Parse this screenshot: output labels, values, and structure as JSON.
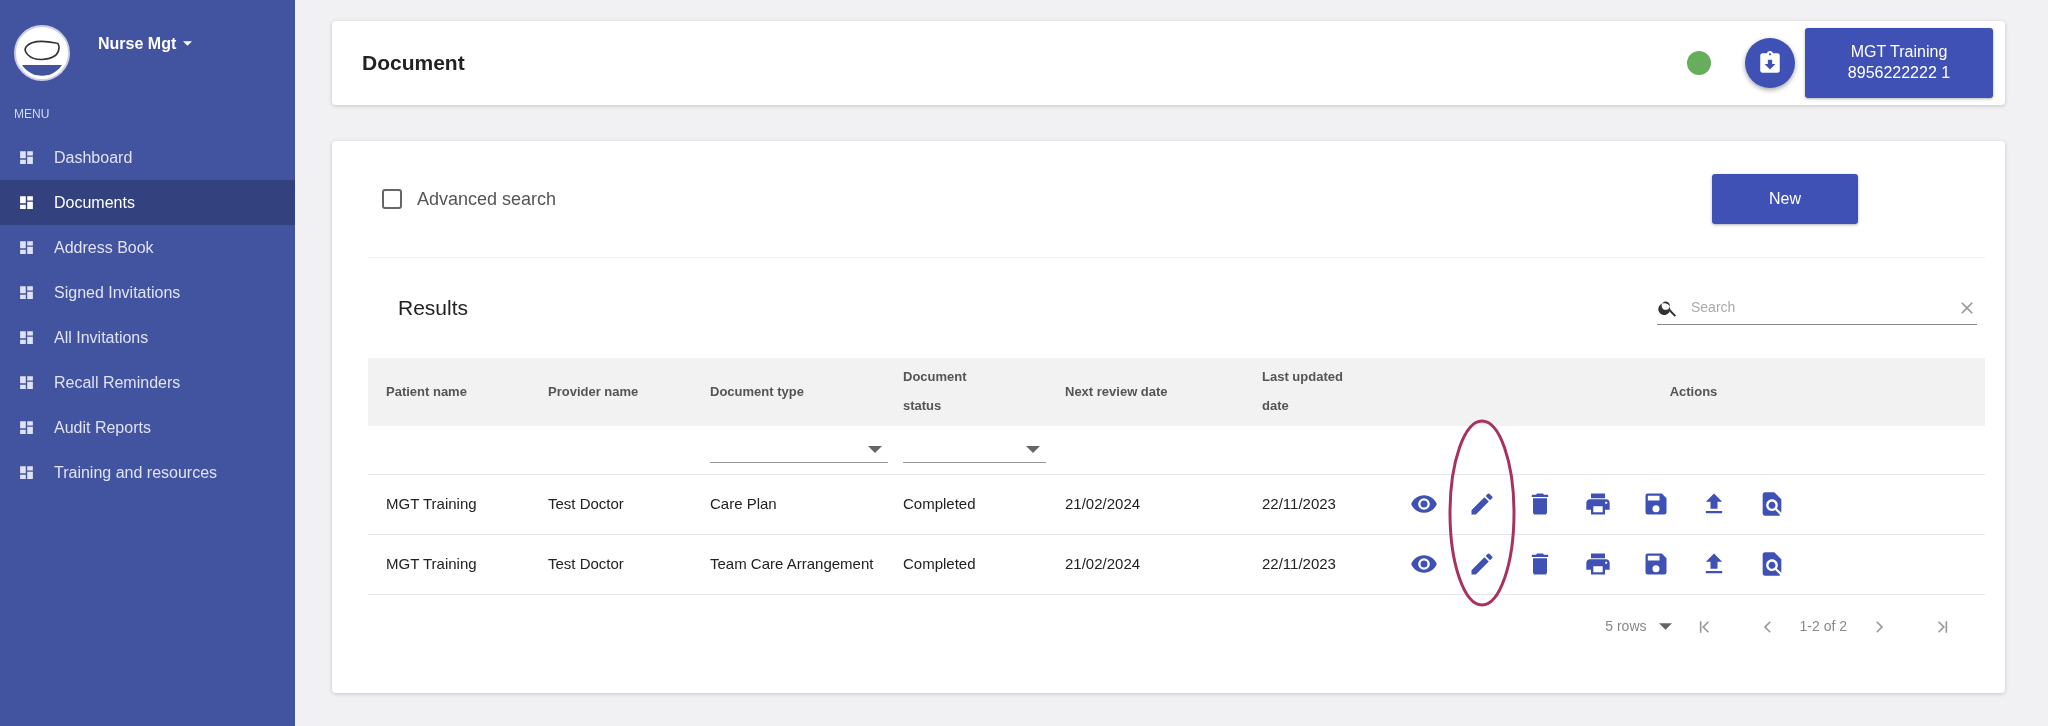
{
  "sidebar": {
    "brand": "Nurse Mgt",
    "section_label": "MENU",
    "items": [
      {
        "label": "Dashboard",
        "selected": false
      },
      {
        "label": "Documents",
        "selected": true
      },
      {
        "label": "Address Book",
        "selected": false
      },
      {
        "label": "Signed Invitations",
        "selected": false
      },
      {
        "label": "All Invitations",
        "selected": false
      },
      {
        "label": "Recall Reminders",
        "selected": false
      },
      {
        "label": "Audit Reports",
        "selected": false
      },
      {
        "label": "Training and resources",
        "selected": false
      }
    ]
  },
  "header": {
    "title": "Document",
    "status": {
      "color": "#66ad5c"
    },
    "user_button": [
      "MGT Training",
      "8956222222 1"
    ]
  },
  "search_panel": {
    "advanced_search": {
      "label": "Advanced search",
      "checked": false
    },
    "new_button": "New"
  },
  "results": {
    "title": "Results",
    "search": {
      "placeholder": "Search"
    },
    "columns": [
      "Patient name",
      "Provider name",
      "Document type",
      "Document\nstatus",
      "Next review date",
      "Last updated\ndate",
      "Actions"
    ],
    "filters": [
      {
        "kind": "none"
      },
      {
        "kind": "none"
      },
      {
        "kind": "dropdown"
      },
      {
        "kind": "dropdown"
      },
      {
        "kind": "none"
      },
      {
        "kind": "none"
      },
      {
        "kind": "none"
      }
    ],
    "rows": [
      {
        "cells": [
          "MGT Training",
          "Test Doctor",
          "Care Plan",
          "Completed",
          "21/02/2024",
          "22/11/2023"
        ]
      },
      {
        "cells": [
          "MGT Training",
          "Test Doctor",
          "Team Care Arrangement",
          "Completed",
          "21/02/2024",
          "22/11/2023"
        ]
      }
    ],
    "pagination": {
      "rows_per_page": "5 rows",
      "range": "1-2 of 2"
    }
  }
}
